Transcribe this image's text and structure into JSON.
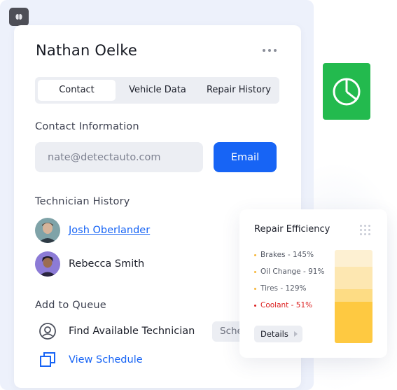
{
  "contact": {
    "name": "Nathan Oelke",
    "tabs": [
      {
        "label": "Contact",
        "active": true
      },
      {
        "label": "Vehicle Data",
        "active": false
      },
      {
        "label": "Repair History",
        "active": false
      }
    ],
    "section_contact": "Contact Information",
    "email_placeholder": "nate@detectauto.com",
    "email_button": "Email",
    "section_history": "Technician History",
    "technicians": [
      {
        "name": "Josh Oberlander",
        "linked": true
      },
      {
        "name": "Rebecca Smith",
        "linked": false
      }
    ],
    "section_queue": "Add to Queue",
    "queue_actions": [
      {
        "label": "Find Available Technician",
        "icon": "user-circle-icon"
      },
      {
        "label": "View Schedule",
        "icon": "copy-squares-icon"
      }
    ],
    "schedule_pill": "Sche"
  },
  "efficiency": {
    "title": "Repair Efficiency",
    "legend": [
      {
        "label": "Brakes - 145%",
        "color": "#f6b73c",
        "alert": false
      },
      {
        "label": "Oil Change - 91%",
        "color": "#f6b73c",
        "alert": false
      },
      {
        "label": "Tires - 129%",
        "color": "#f6b73c",
        "alert": false
      },
      {
        "label": "Coolant - 51%",
        "color": "#dc1f1f",
        "alert": true
      }
    ],
    "details_button": "Details",
    "bar_colors": [
      "#fdf0d2",
      "#fde7b1",
      "#fddc84",
      "#fec941"
    ]
  },
  "colors": {
    "accent": "#1764f5",
    "pie_tile": "#23ba4e",
    "alert": "#dc1f1f"
  }
}
